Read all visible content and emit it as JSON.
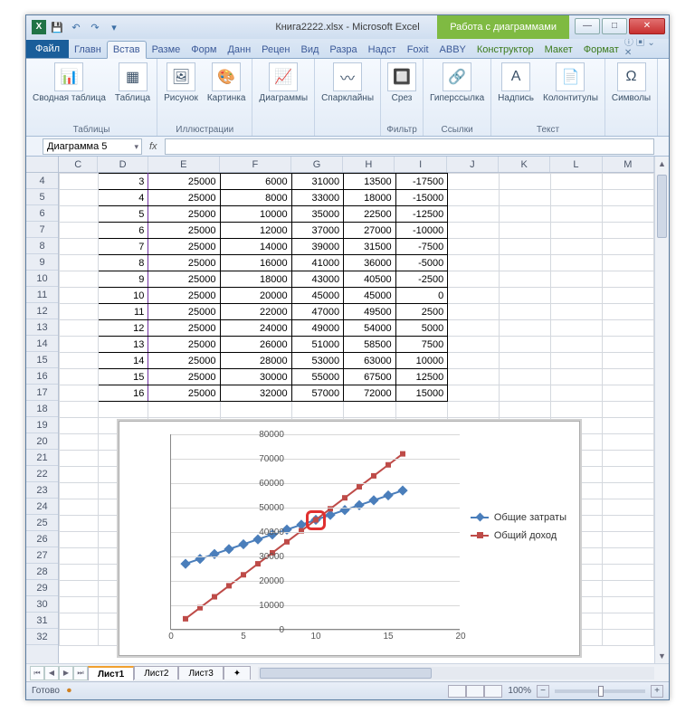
{
  "title": {
    "filename": "Книга2222.xlsx",
    "app": "Microsoft Excel",
    "tools_tab": "Работа с диаграммами"
  },
  "qat": {
    "save": "💾",
    "undo": "↶",
    "redo": "↷"
  },
  "tabs": {
    "file": "Файл",
    "items": [
      "Главн",
      "Встав",
      "Разме",
      "Форм",
      "Данн",
      "Рецен",
      "Вид",
      "Разра",
      "Надст",
      "Foxit",
      "ABBY"
    ],
    "ctx": [
      "Конструктор",
      "Макет",
      "Формат"
    ]
  },
  "ribbon": {
    "groups": [
      {
        "label": "Таблицы",
        "buttons": [
          "Сводная таблица",
          "Таблица"
        ]
      },
      {
        "label": "Иллюстрации",
        "buttons": [
          "Рисунок",
          "Картинка"
        ]
      },
      {
        "label": "",
        "buttons": [
          "Диаграммы"
        ]
      },
      {
        "label": "",
        "buttons": [
          "Спарклайны"
        ]
      },
      {
        "label": "Фильтр",
        "buttons": [
          "Срез"
        ]
      },
      {
        "label": "Ссылки",
        "buttons": [
          "Гиперссылка"
        ]
      },
      {
        "label": "Текст",
        "buttons": [
          "Надпись",
          "Колонтитулы"
        ]
      },
      {
        "label": "",
        "buttons": [
          "Символы"
        ]
      }
    ]
  },
  "namebox": "Диаграмма 5",
  "fx_label": "fx",
  "columns": [
    "C",
    "D",
    "E",
    "F",
    "G",
    "H",
    "I",
    "J",
    "K",
    "L",
    "M"
  ],
  "row_start": 4,
  "row_end": 32,
  "table_rows": [
    [
      3,
      25000,
      6000,
      31000,
      13500,
      -17500
    ],
    [
      4,
      25000,
      8000,
      33000,
      18000,
      -15000
    ],
    [
      5,
      25000,
      10000,
      35000,
      22500,
      -12500
    ],
    [
      6,
      25000,
      12000,
      37000,
      27000,
      -10000
    ],
    [
      7,
      25000,
      14000,
      39000,
      31500,
      -7500
    ],
    [
      8,
      25000,
      16000,
      41000,
      36000,
      -5000
    ],
    [
      9,
      25000,
      18000,
      43000,
      40500,
      -2500
    ],
    [
      10,
      25000,
      20000,
      45000,
      45000,
      0
    ],
    [
      11,
      25000,
      22000,
      47000,
      49500,
      2500
    ],
    [
      12,
      25000,
      24000,
      49000,
      54000,
      5000
    ],
    [
      13,
      25000,
      26000,
      51000,
      58500,
      7500
    ],
    [
      14,
      25000,
      28000,
      53000,
      63000,
      10000
    ],
    [
      15,
      25000,
      30000,
      55000,
      67500,
      12500
    ],
    [
      16,
      25000,
      32000,
      57000,
      72000,
      15000
    ]
  ],
  "chart_data": {
    "type": "line",
    "x": [
      1,
      2,
      3,
      4,
      5,
      6,
      7,
      8,
      9,
      10,
      11,
      12,
      13,
      14,
      15,
      16
    ],
    "series": [
      {
        "name": "Общие затраты",
        "color": "#4a7ebb",
        "marker": "diamond",
        "values": [
          27000,
          29000,
          31000,
          33000,
          35000,
          37000,
          39000,
          41000,
          43000,
          45000,
          47000,
          49000,
          51000,
          53000,
          55000,
          57000
        ]
      },
      {
        "name": "Общий доход",
        "color": "#be4b48",
        "marker": "square",
        "values": [
          4500,
          9000,
          13500,
          18000,
          22500,
          27000,
          31500,
          36000,
          40500,
          45000,
          49500,
          54000,
          58500,
          63000,
          67500,
          72000
        ]
      }
    ],
    "xlim": [
      0,
      20
    ],
    "ylim": [
      0,
      80000
    ],
    "yticks": [
      0,
      10000,
      20000,
      30000,
      40000,
      50000,
      60000,
      70000,
      80000
    ],
    "xticks": [
      0,
      5,
      10,
      15,
      20
    ],
    "highlight_x": 10
  },
  "sheet_tabs": [
    "Лист1",
    "Лист2",
    "Лист3"
  ],
  "status": {
    "ready": "Готово",
    "zoom": "100%"
  }
}
